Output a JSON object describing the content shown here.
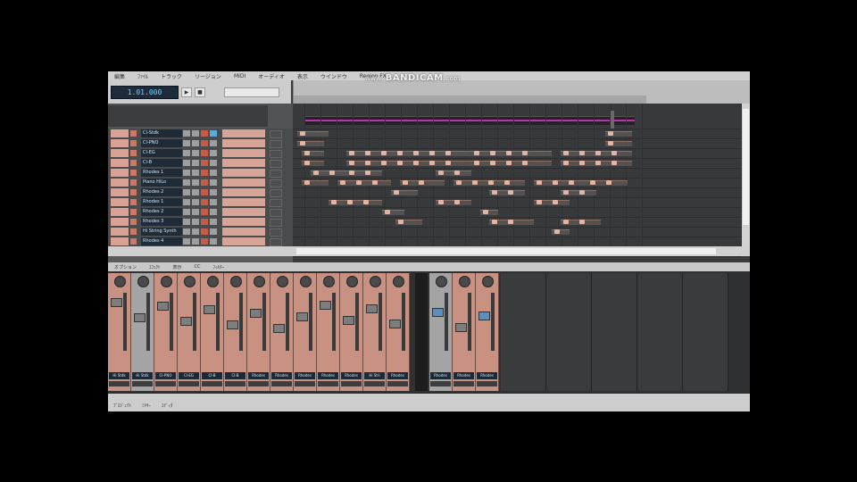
{
  "watermark": {
    "prefix": "www.",
    "brand": "BANDICAM",
    "suffix": ".com"
  },
  "menu": [
    "編集",
    "ﾌｧｲﾙ",
    "トラック",
    "リージョン",
    "MIDI",
    "オーディオ",
    "表示",
    "ウインドウ",
    "Region FX"
  ],
  "transport": {
    "position": "1.01.000"
  },
  "colors": {
    "track": "#d9a294",
    "midi_region": "#b03aa8",
    "lcd_text": "#6fd0ff"
  },
  "tracks": [
    {
      "name": "CI-Stdk"
    },
    {
      "name": "CI-PNO"
    },
    {
      "name": "CI-EG"
    },
    {
      "name": "CI-B"
    },
    {
      "name": "Rhodes 1"
    },
    {
      "name": "Piano HiLo"
    },
    {
      "name": "Rhodes 2"
    },
    {
      "name": "Rhodes 1"
    },
    {
      "name": "Rhodes 2"
    },
    {
      "name": "Rhodes 3"
    },
    {
      "name": "Hi String Synth"
    },
    {
      "name": "Rhodes 4"
    }
  ],
  "mixer": {
    "menu": [
      "オプション",
      "ｴﾌｪｸﾄ",
      "表示",
      "CC",
      "ﾌｨﾙﾀｰ"
    ],
    "strips": [
      "Hi Stdk",
      "Hi Stdk",
      "CI-PNO",
      "CI-EG",
      "CI-B",
      "CI-B",
      "Rhodes",
      "Rhodes",
      "Rhodes",
      "Rhodes",
      "Rhodes",
      "Hi Stri",
      "Rhodes",
      "Rhodes",
      "Rhodes",
      "Rhodes"
    ]
  },
  "footer": {
    "tabs": [
      "ﾌﾟﾛｼﾞｪｸﾄ",
      "ﾐｷｻｰ",
      "ｴﾃﾞｨﾀ"
    ]
  }
}
